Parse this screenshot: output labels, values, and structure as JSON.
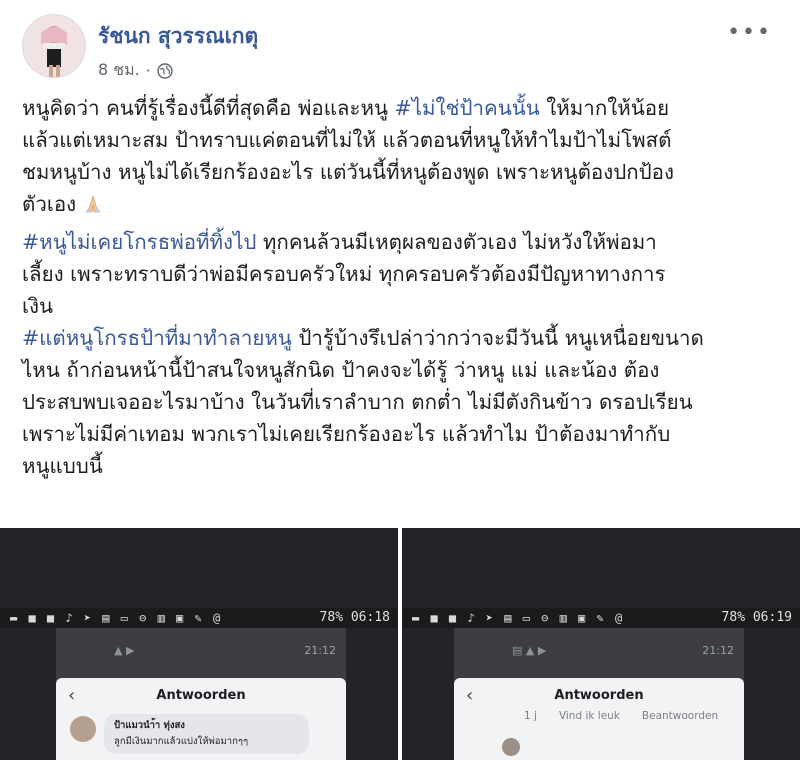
{
  "post": {
    "author": "รัชนก สุวรรณเกตุ",
    "time": "8 ชม.",
    "privacy_icon": "globe-icon",
    "more_icon": "more-options-icon",
    "paragraphs": [
      {
        "lines": [
          [
            {
              "t": "หนูคิดว่า คนที่รู้เรื่องนี้ดีที่สุดคือ พ่อและหนู "
            },
            {
              "t": "#ไม่ใช่ป้าคนนั้น",
              "tag": true
            },
            {
              "t": " ให้มากให้น้อย"
            }
          ],
          [
            {
              "t": "แล้วแต่เหมาะสม ป้าทราบแค่ตอนที่ไม่ให้ แล้วตอนที่หนูให้ทำไมป้าไม่โพสต์"
            }
          ],
          [
            {
              "t": "ชมหนูบ้าง หนูไม่ได้เรียกร้องอะไร แต่วันนี้ที่หนูต้องพูด เพราะหนูต้องปกป้อง"
            }
          ],
          [
            {
              "t": "ตัวเอง "
            }
          ]
        ],
        "emoji_after": "praying-hands-icon"
      },
      {
        "lines": [
          [
            {
              "t": "#หนูไม่เคยโกรธพ่อที่ทิ้งไป",
              "tag": true
            },
            {
              "t": " ทุกคนล้วนมีเหตุผลของตัวเอง ไม่หวังให้พ่อมา"
            }
          ],
          [
            {
              "t": "เลี้ยง เพราะทราบดีว่าพ่อมีครอบครัวใหม่ ทุกครอบครัวต้องมีปัญหาทางการ"
            }
          ],
          [
            {
              "t": "เงิน"
            }
          ]
        ]
      },
      {
        "lines": [
          [
            {
              "t": "#แต่หนูโกรธป้าที่มาทำลายหนู",
              "tag": true
            },
            {
              "t": " ป้ารู้บ้างรึเปล่าว่ากว่าจะมีวันนี้ หนูเหนื่อยขนาด"
            }
          ],
          [
            {
              "t": "ไหน ถ้าก่อนหน้านี้ป้าสนใจหนูสักนิด ป้าคงจะได้รู้ ว่าหนู แม่ และน้อง ต้อง"
            }
          ],
          [
            {
              "t": "ประสบพบเจออะไรมาบ้าง ในวันที่เราลำบาก ตกต่ำ ไม่มีตังกินข้าว ดรอปเรียน"
            }
          ],
          [
            {
              "t": "เพราะไม่มีค่าเทอม พวกเราไม่เคยเรียกร้องอะไร แล้วทำไม ป้าต้องมาทำกับ"
            }
          ],
          [
            {
              "t": "หนูแบบนี้"
            }
          ]
        ]
      }
    ]
  },
  "screenshots": {
    "left": {
      "status_time": "78% 06:18",
      "inner_clock": "21:12",
      "dialog_title": "Antwoorden",
      "comment_name": "ป้าแมวนำ้า ทุ่งสง",
      "comment_text": "ลูกมีเงินมากแล้วแบ่งให้พ่อมากๆๆ"
    },
    "right": {
      "status_time": "78% 06:19",
      "inner_clock": "21:12",
      "dialog_title": "Antwoorden",
      "reply_count": "1 j",
      "like_label": "Vind ik leuk",
      "reply_label": "Beantwoorden"
    }
  },
  "colors": {
    "link": "#385898",
    "text": "#1c1e21",
    "meta": "#606770"
  }
}
